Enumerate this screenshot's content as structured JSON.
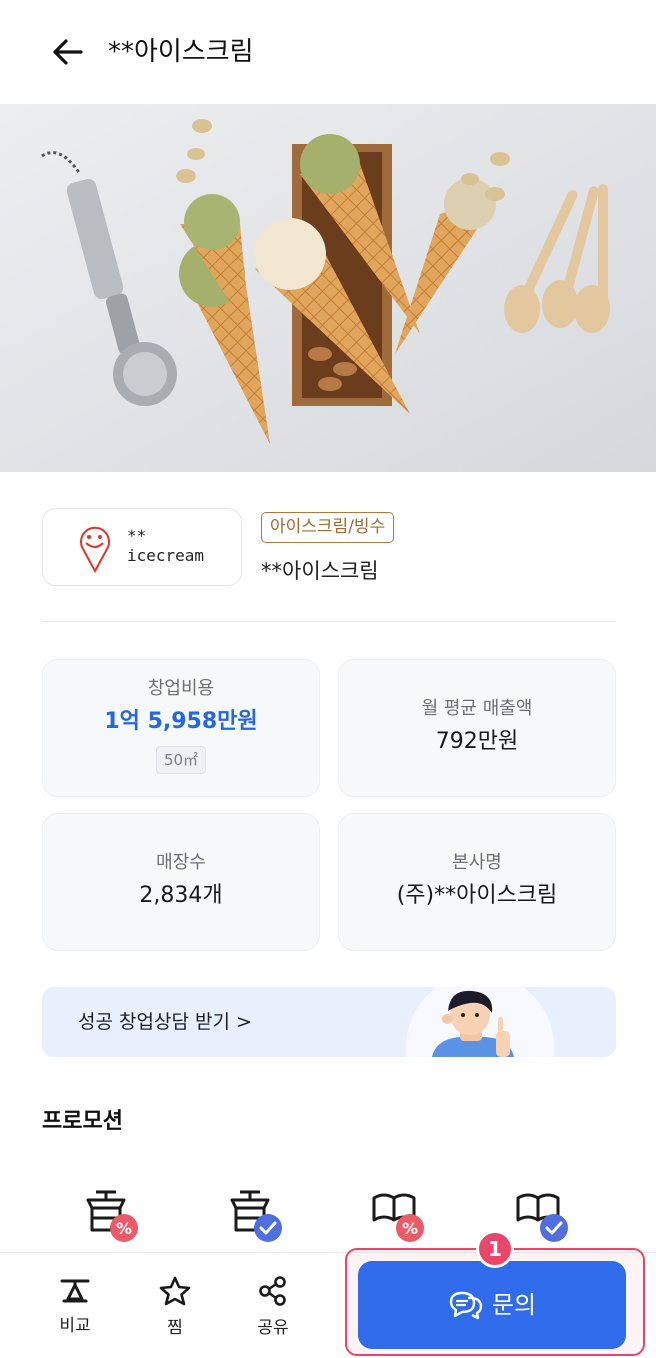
{
  "header": {
    "title": "**아이스크림"
  },
  "brand": {
    "logo_text_top": "**",
    "logo_text_bottom": "icecream",
    "category": "아이스크림/빙수",
    "name": "**아이스크림"
  },
  "stats": {
    "startup_cost": {
      "label": "창업비용",
      "value": "1억 5,958만원",
      "area": "50㎡"
    },
    "monthly_sales": {
      "label": "월 평균 매출액",
      "value": "792만원"
    },
    "store_count": {
      "label": "매장수",
      "value": "2,834개"
    },
    "company": {
      "label": "본사명",
      "value": "(주)**아이스크림"
    }
  },
  "consult_banner": {
    "text": "성공 창업상담 받기 >"
  },
  "promotion": {
    "title": "프로모션",
    "icons": [
      "store-discount-icon",
      "store-check-icon",
      "book-discount-icon",
      "book-check-icon"
    ]
  },
  "bottom_nav": {
    "compare": "비교",
    "favorite": "찜",
    "share": "공유",
    "inquiry": "문의",
    "step_number": "1"
  },
  "colors": {
    "accent": "#2f6bea",
    "price_blue": "#2566e8",
    "badge_red": "#e9466a",
    "category_brown": "#a06a30"
  }
}
